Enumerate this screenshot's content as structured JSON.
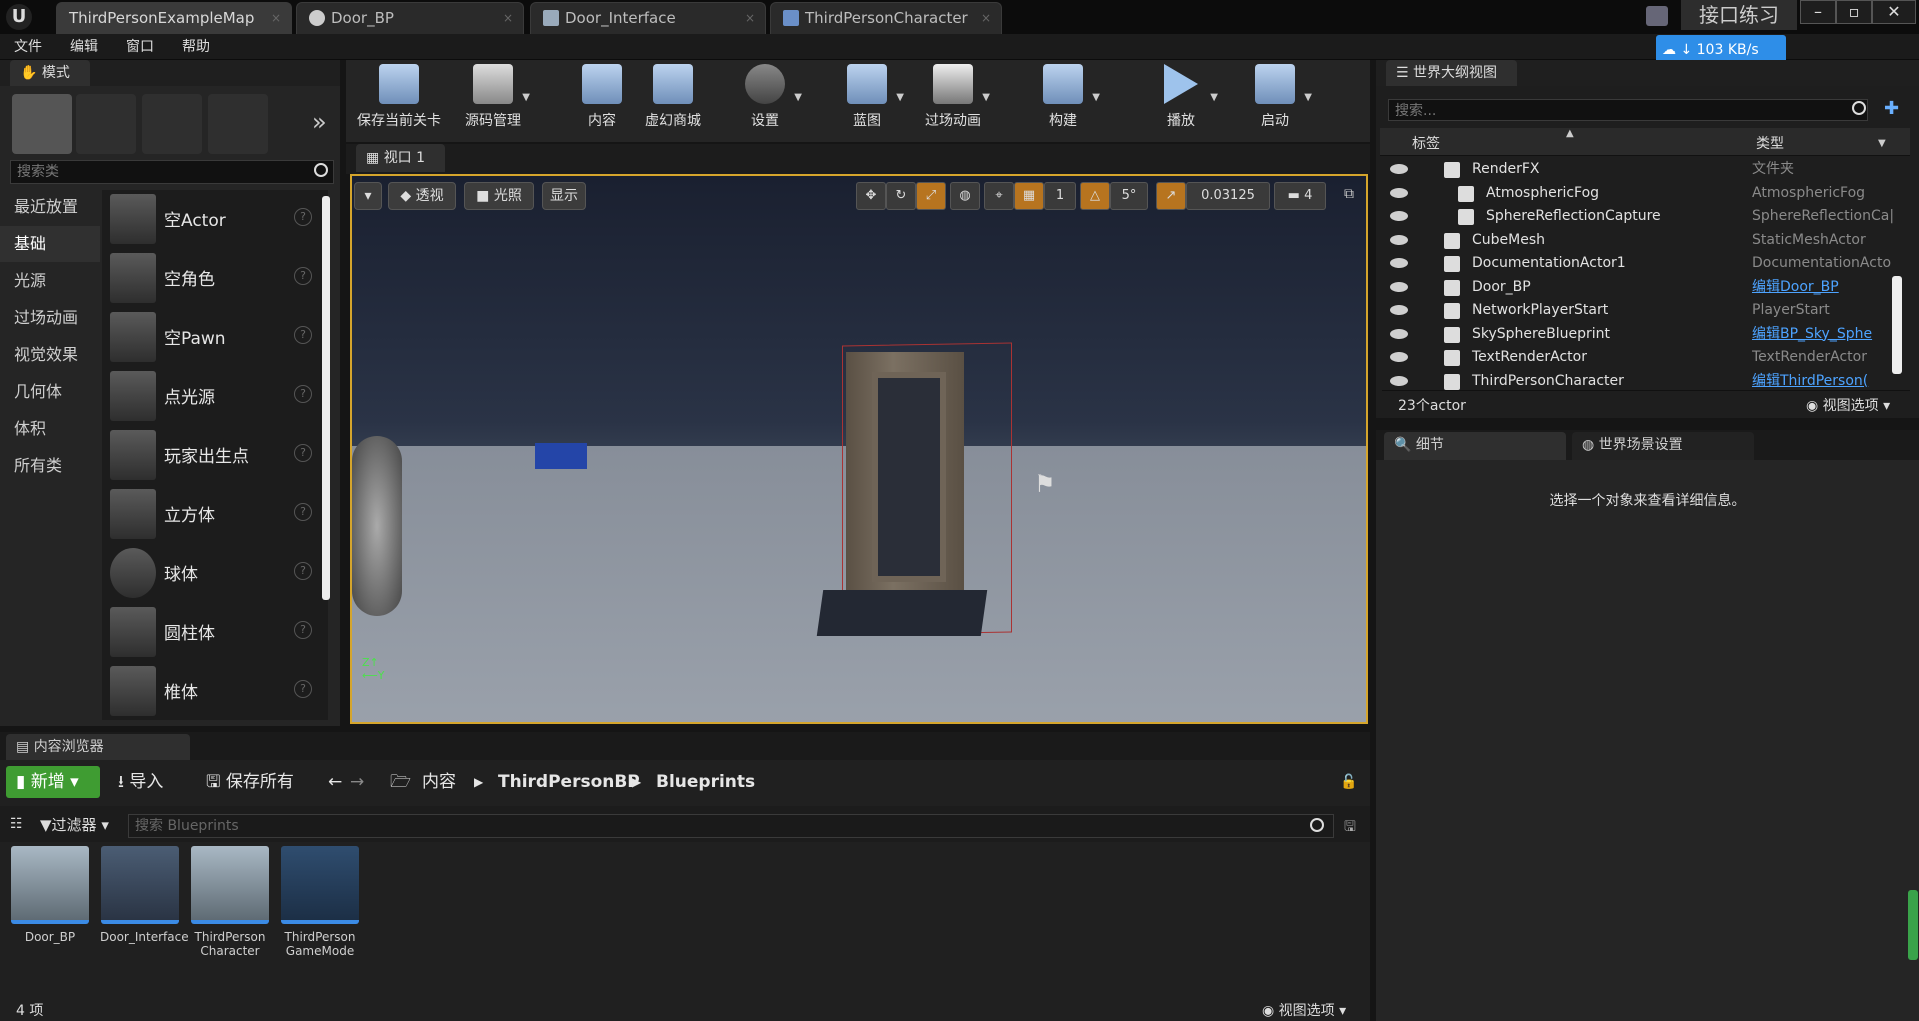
{
  "tabs": [
    {
      "label": "ThirdPersonExampleMap",
      "active": true
    },
    {
      "label": "Door_BP"
    },
    {
      "label": "Door_Interface"
    },
    {
      "label": "ThirdPersonCharacter"
    }
  ],
  "project_name": "接口练习",
  "net_speed": "103 KB/s",
  "menu": [
    "文件",
    "编辑",
    "窗口",
    "帮助"
  ],
  "modes": {
    "title": "模式",
    "search_placeholder": "搜索类",
    "categories": [
      "最近放置",
      "基础",
      "光源",
      "过场动画",
      "视觉效果",
      "几何体",
      "体积",
      "所有类"
    ],
    "selected_category": "基础",
    "items": [
      "空Actor",
      "空角色",
      "空Pawn",
      "点光源",
      "玩家出生点",
      "立方体",
      "球体",
      "圆柱体",
      "椎体"
    ]
  },
  "toolbar": [
    {
      "label": "保存当前关卡",
      "icon": "save-icon"
    },
    {
      "label": "源码管理",
      "icon": "source-control-icon"
    },
    {
      "label": "内容",
      "icon": "content-icon"
    },
    {
      "label": "虚幻商城",
      "icon": "marketplace-icon"
    },
    {
      "label": "设置",
      "icon": "settings-icon"
    },
    {
      "label": "蓝图",
      "icon": "blueprint-icon"
    },
    {
      "label": "过场动画",
      "icon": "cinematics-icon"
    },
    {
      "label": "构建",
      "icon": "build-icon"
    },
    {
      "label": "播放",
      "icon": "play-icon"
    },
    {
      "label": "启动",
      "icon": "launch-icon"
    }
  ],
  "viewport": {
    "tab": "视口 1",
    "perspective": "透视",
    "lighting": "光照",
    "show": "显示",
    "grid_snap": "1",
    "rotation_snap": "5°",
    "scale_snap": "0.03125",
    "camera_speed": "4"
  },
  "outliner": {
    "title": "世界大纲视图",
    "search_placeholder": "搜索...",
    "col_label": "标签",
    "col_type": "类型",
    "rows": [
      {
        "label": "RenderFX",
        "type": "文件夹",
        "indent": 1,
        "link": false,
        "icon": "folder-icon"
      },
      {
        "label": "AtmosphericFog",
        "type": "AtmosphericFog",
        "indent": 2,
        "link": false,
        "icon": "fog-icon"
      },
      {
        "label": "SphereReflectionCapture",
        "type": "SphereReflectionCa|",
        "indent": 2,
        "link": false,
        "icon": "reflection-icon"
      },
      {
        "label": "CubeMesh",
        "type": "StaticMeshActor",
        "indent": 1,
        "link": false,
        "icon": "mesh-icon"
      },
      {
        "label": "DocumentationActor1",
        "type": "DocumentationActo",
        "indent": 1,
        "link": false,
        "icon": "doc-icon"
      },
      {
        "label": "Door_BP",
        "type": "编辑Door_BP",
        "indent": 1,
        "link": true,
        "icon": "actor-icon"
      },
      {
        "label": "NetworkPlayerStart",
        "type": "PlayerStart",
        "indent": 1,
        "link": false,
        "icon": "flag-icon"
      },
      {
        "label": "SkySphereBlueprint",
        "type": "编辑BP_Sky_Sphe",
        "indent": 1,
        "link": true,
        "icon": "sphere-icon"
      },
      {
        "label": "TextRenderActor",
        "type": "TextRenderActor",
        "indent": 1,
        "link": false,
        "icon": "text-icon"
      },
      {
        "label": "ThirdPersonCharacter",
        "type": "编辑ThirdPerson(",
        "indent": 1,
        "link": true,
        "icon": "character-icon"
      }
    ],
    "count": "23个actor",
    "view_options": "视图选项"
  },
  "details": {
    "tab_details": "细节",
    "tab_world": "世界场景设置",
    "empty_msg": "选择一个对象来查看详细信息。"
  },
  "content_browser": {
    "title": "内容浏览器",
    "add_new": "新增",
    "import": "导入",
    "save_all": "保存所有",
    "path": [
      "内容",
      "ThirdPersonBP",
      "Blueprints"
    ],
    "filters": "过滤器",
    "search_placeholder": "搜索 Blueprints",
    "assets": [
      {
        "line1": "Door_BP",
        "line2": ""
      },
      {
        "line1": "Door_Interface",
        "line2": ""
      },
      {
        "line1": "ThirdPerson",
        "line2": "Character"
      },
      {
        "line1": "ThirdPerson",
        "line2": "GameMode"
      }
    ],
    "item_count": "4 项",
    "view_options": "视图选项"
  }
}
